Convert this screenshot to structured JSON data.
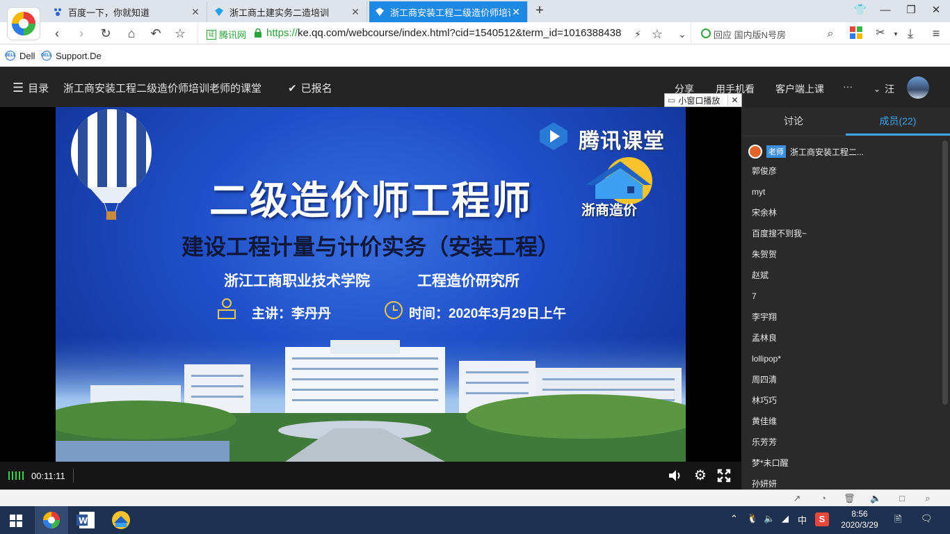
{
  "browser": {
    "tabs": [
      {
        "label": "百度一下，你就知道"
      },
      {
        "label": "浙工商土建实务二造培训"
      },
      {
        "label": "浙工商安装工程二级造价师培训"
      }
    ],
    "address": {
      "site_label": "腾讯网",
      "url_https": "https://",
      "url_rest": "ke.qq.com/webcourse/index.html?cid=1540512&term_id=1016388438"
    },
    "search": {
      "placeholder": "回应 国内版N号房"
    },
    "bookmarks": [
      {
        "label": "Dell"
      },
      {
        "label": "Support.De"
      }
    ]
  },
  "page_header": {
    "menu_label": "目录",
    "course_title": "浙工商安装工程二级造价师培训老师的课堂",
    "enrolled_label": "已报名",
    "actions": [
      "分享",
      "用手机看",
      "客户端上课",
      "···"
    ],
    "user_label": "汪",
    "mini_window_label": "小窗口播放"
  },
  "slide": {
    "brand": "腾讯课堂",
    "logo_text": "浙商造价",
    "title": "二级造价师工程师",
    "subtitle": "建设工程计量与计价实务（安装工程）",
    "org_left": "浙江工商职业技术学院",
    "org_right": "工程造价研究所",
    "speaker": "主讲：李丹丹",
    "time": "时间：2020年3月29日上午"
  },
  "player": {
    "elapsed": "00:11:11"
  },
  "right_panel": {
    "tabs": [
      {
        "label": "讨论"
      },
      {
        "label": "成员(22)"
      }
    ],
    "teacher_badge": "老师",
    "teacher_name": "浙工商安装工程二...",
    "members": [
      "郭俊彦",
      "myt",
      "宋余林",
      "百度搜不到我~",
      "朱贺贺",
      "赵斌",
      "7",
      "李宇翔",
      "孟林良",
      "lollipop*",
      "周四清",
      "林巧巧",
      "黄佳维",
      "乐芳芳",
      "梦*未口醒",
      "孙妍妍"
    ]
  },
  "taskbar": {
    "ime": "中",
    "time": "8:56",
    "date": "2020/3/29"
  },
  "colors": {
    "accent": "#1e88e5",
    "panel_active": "#3aa5f0",
    "teacher_badge": "#3d8fe0"
  }
}
